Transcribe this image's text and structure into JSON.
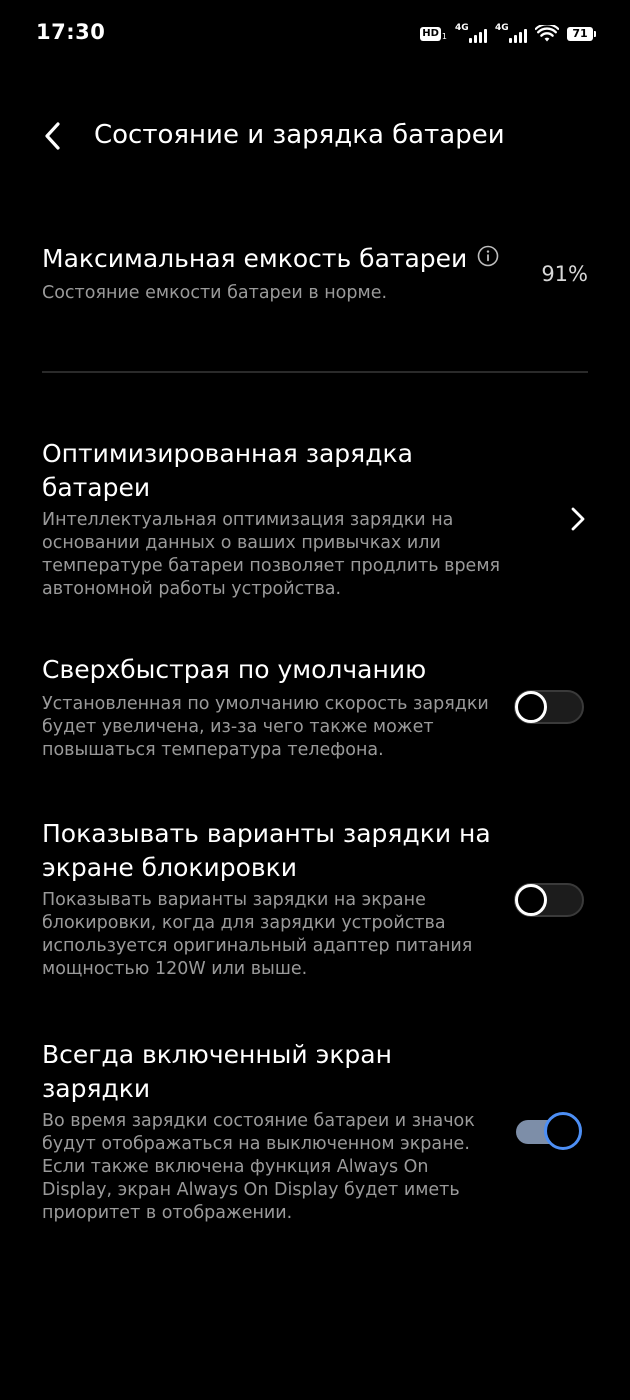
{
  "status_bar": {
    "time": "17:30",
    "hd_label": "HD",
    "hd_sub": "1",
    "net1_label": "4G",
    "net2_label": "4G",
    "battery_level": "71"
  },
  "header": {
    "title": "Состояние и зарядка батареи"
  },
  "settings": {
    "max_capacity": {
      "title": "Максимальная емкость батареи",
      "value": "91%",
      "description": "Состояние емкости батареи в норме."
    },
    "optimized_charging": {
      "title": "Оптимизированная зарядка батареи",
      "description": "Интеллектуальная оптимизация зарядки на основании данных о ваших привычках или температуре батареи позволяет продлить время автономной работы устройства."
    },
    "superfast_default": {
      "title": "Сверхбыстрая по умолчанию",
      "description": "Установленная по умолчанию скорость зарядки будет увеличена, из-за чего также может повышаться температура телефона.",
      "enabled": false
    },
    "lockscreen_options": {
      "title": "Показывать варианты зарядки на экране блокировки",
      "description": "Показывать варианты зарядки на экране блокировки, когда для зарядки устройства используется оригинальный адаптер питания мощностью 120W или выше.",
      "enabled": false
    },
    "always_on_charging": {
      "title": "Всегда включенный экран зарядки",
      "description": "Во время зарядки состояние батареи и значок будут отображаться на выключенном экране. Если также включена функция Always On Display, экран Always On Display будет иметь приоритет в отображении.",
      "enabled": true
    }
  },
  "colors": {
    "background": "#000000",
    "accent": "#4d8ff5",
    "secondary_text": "#9a9a9a"
  }
}
